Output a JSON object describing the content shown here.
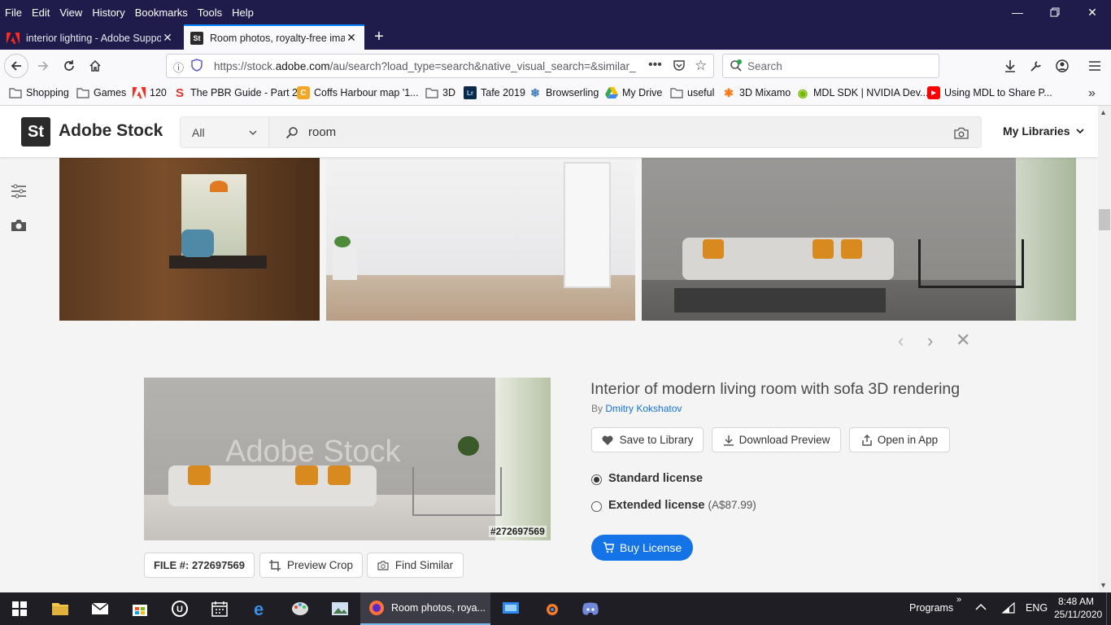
{
  "menubar": {
    "items": [
      "File",
      "Edit",
      "View",
      "History",
      "Bookmarks",
      "Tools",
      "Help"
    ]
  },
  "tabs": [
    {
      "title": "interior lighting - Adobe Suppo",
      "favicon": "adobe-icon"
    },
    {
      "title": "Room photos, royalty-free ima",
      "favicon": "adobe-stock-icon"
    }
  ],
  "nav": {
    "url_prefix": "https://stock.",
    "url_domain": "adobe.com",
    "url_rest": "/au/search?load_type=search&native_visual_search=&similar_",
    "search_placeholder": "Search"
  },
  "bookmarks": [
    {
      "label": "Shopping",
      "icon": "folder-icon"
    },
    {
      "label": "Games",
      "icon": "folder-icon"
    },
    {
      "label": "120",
      "icon": "adobe-icon"
    },
    {
      "label": "The PBR Guide - Part 2",
      "icon": "substance-icon"
    },
    {
      "label": "Coffs Harbour map '1...",
      "icon": "map-icon"
    },
    {
      "label": "3D",
      "icon": "folder-icon"
    },
    {
      "label": "Tafe 2019",
      "icon": "lightroom-icon"
    },
    {
      "label": "Browserling",
      "icon": "browserling-icon"
    },
    {
      "label": "My Drive",
      "icon": "drive-icon"
    },
    {
      "label": "useful",
      "icon": "folder-icon"
    },
    {
      "label": "3D Mixamo",
      "icon": "mixamo-icon"
    },
    {
      "label": "MDL SDK | NVIDIA Dev...",
      "icon": "nvidia-icon"
    },
    {
      "label": "Using MDL to Share P...",
      "icon": "youtube-icon"
    }
  ],
  "stock": {
    "logo_badge": "St",
    "logo_text": "Adobe Stock",
    "scope": "All",
    "query": "room",
    "my_libraries": "My Libraries"
  },
  "detail": {
    "title": "Interior of modern living room with sofa 3D rendering",
    "by_prefix": "By",
    "author": "Dmitry Kokshatov",
    "file_id_label": "FILE #:",
    "file_id": "272697569",
    "watermark_id": "#272697569",
    "watermark_text": "Adobe Stock",
    "actions": {
      "save": "Save to Library",
      "download": "Download Preview",
      "open": "Open in App",
      "preview_crop": "Preview Crop",
      "find_similar": "Find Similar"
    },
    "licenses": {
      "standard": "Standard license",
      "extended": "Extended license",
      "extended_price": "(A$87.99)",
      "selected": "standard"
    },
    "buy": "Buy License"
  },
  "taskbar": {
    "active_title": "Room photos, roya...",
    "programs": "Programs",
    "lang": "ENG",
    "time": "8:48 AM",
    "date": "25/11/2020"
  },
  "colors": {
    "firefox_dark": "#1f1b4b",
    "accent": "#1473e6",
    "taskbar": "#1e1e24"
  }
}
